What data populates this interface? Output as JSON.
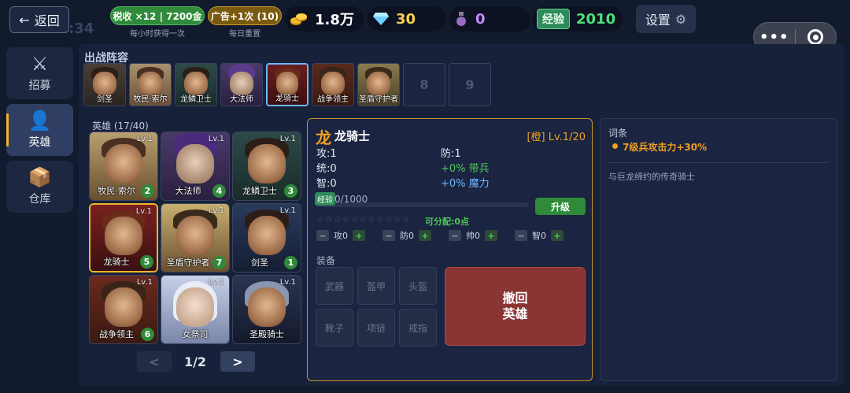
{
  "topbar": {
    "back_label": "返回",
    "back_icon": "arrow-left-icon",
    "clock": "02:34",
    "tax_pill": "税收 ×12 | 7200金",
    "tax_note": "每小时获得一次",
    "ad_pill": "广告+1次 (10)",
    "ad_note": "每日重置",
    "gold": "1.8万",
    "gems": "30",
    "potions": "0",
    "exp_label": "经验",
    "exp_value": "2010",
    "settings_label": "设置"
  },
  "sidenav": {
    "items": [
      {
        "label": "招募",
        "icon": "crossed-swords-icon"
      },
      {
        "label": "英雄",
        "icon": "person-icon"
      },
      {
        "label": "仓库",
        "icon": "box-icon"
      }
    ]
  },
  "lineup": {
    "title": "出战阵容",
    "slots": [
      {
        "name": "剑圣"
      },
      {
        "name": "牧民·索尔"
      },
      {
        "name": "龙鳞卫士"
      },
      {
        "name": "大法师"
      },
      {
        "name": "龙骑士"
      },
      {
        "name": "战争领主"
      },
      {
        "name": "圣盾守护者"
      }
    ],
    "empty_slots": [
      "8",
      "9"
    ]
  },
  "heroes": {
    "title": "英雄 (17/40)",
    "cards": [
      {
        "name": "牧民·索尔",
        "level": "Lv.1",
        "count": "2"
      },
      {
        "name": "大法师",
        "level": "Lv.1",
        "count": "4"
      },
      {
        "name": "龙鳞卫士",
        "level": "Lv.1",
        "count": "3"
      },
      {
        "name": "龙骑士",
        "level": "Lv.1",
        "count": "5"
      },
      {
        "name": "圣盾守护者",
        "level": "Lv.1",
        "count": "7"
      },
      {
        "name": "剑圣",
        "level": "Lv.1",
        "count": "1"
      },
      {
        "name": "战争领主",
        "level": "Lv.1",
        "count": "6"
      },
      {
        "name": "女祭司",
        "level": "Lv.1",
        "count": ""
      },
      {
        "name": "圣殿骑士",
        "level": "Lv.1",
        "count": ""
      }
    ],
    "prev": "<",
    "page": "1/2",
    "next": ">"
  },
  "detail": {
    "glyph": "龙",
    "name": "龙骑士",
    "rank_level": "[橙] Lv.1/20",
    "attack": "攻:1",
    "defense": "防:1",
    "command": "统:0",
    "troop_bonus": "+0% 带兵",
    "intel": "智:0",
    "magic_bonus": "+0% 魔力",
    "exp_tag": "经验",
    "exp_text": "0/1000",
    "upgrade_label": "升级",
    "stars": "☆☆☆☆☆☆☆☆☆☆☆",
    "assignable": "可分配:0点",
    "steppers": [
      {
        "label": "攻0"
      },
      {
        "label": "防0"
      },
      {
        "label": "帅0"
      },
      {
        "label": "智0"
      }
    ],
    "equip_title": "装备",
    "equip_slots": [
      "武器",
      "盔甲",
      "头盔",
      "靴子",
      "项链",
      "戒指"
    ],
    "withdraw_label": [
      "撤回",
      "英雄"
    ]
  },
  "traits": {
    "title": "词条",
    "bullet": "7级兵攻击力+30%",
    "description": "与巨龙缔约的传奇骑士"
  },
  "colors": {
    "accent_gold": "#f0b429",
    "green": "#4ec85a",
    "blue": "#6fb6ff",
    "withdraw_red": "#8a3434"
  }
}
